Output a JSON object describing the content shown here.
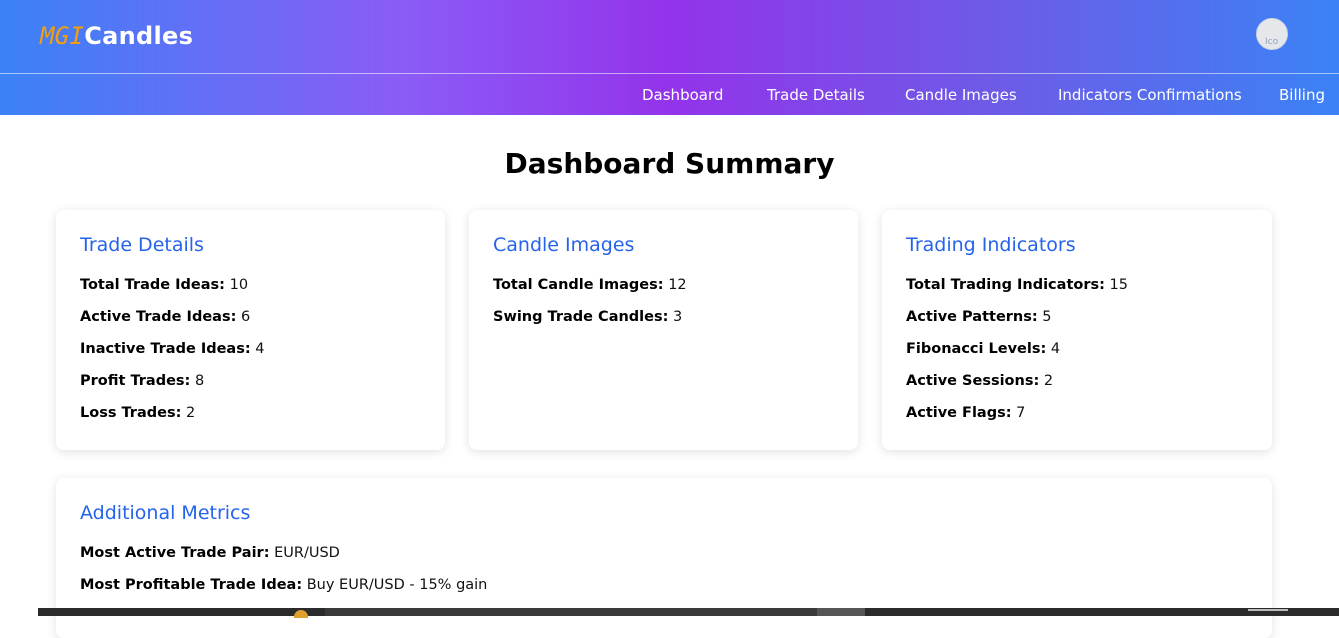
{
  "brand": {
    "mgi": "MGI",
    "name": "Candles"
  },
  "avatar": {
    "alt": "Ico"
  },
  "nav": [
    "Dashboard",
    "Trade Details",
    "Candle Images",
    "Indicators Confirmations",
    "Billing"
  ],
  "page_title": "Dashboard Summary",
  "cards": {
    "trade_details": {
      "title": "Trade Details",
      "rows": [
        {
          "label": "Total Trade Ideas:",
          "value": "10"
        },
        {
          "label": "Active Trade Ideas:",
          "value": "6"
        },
        {
          "label": "Inactive Trade Ideas:",
          "value": "4"
        },
        {
          "label": "Profit Trades:",
          "value": "8"
        },
        {
          "label": "Loss Trades:",
          "value": "2"
        }
      ]
    },
    "candle_images": {
      "title": "Candle Images",
      "rows": [
        {
          "label": "Total Candle Images:",
          "value": "12"
        },
        {
          "label": "Swing Trade Candles:",
          "value": "3"
        }
      ]
    },
    "trading_indicators": {
      "title": "Trading Indicators",
      "rows": [
        {
          "label": "Total Trading Indicators:",
          "value": "15"
        },
        {
          "label": "Active Patterns:",
          "value": "5"
        },
        {
          "label": "Fibonacci Levels:",
          "value": "4"
        },
        {
          "label": "Active Sessions:",
          "value": "2"
        },
        {
          "label": "Active Flags:",
          "value": "7"
        }
      ]
    },
    "additional_metrics": {
      "title": "Additional Metrics",
      "rows": [
        {
          "label": "Most Active Trade Pair:",
          "value": "EUR/USD"
        },
        {
          "label": "Most Profitable Trade Idea:",
          "value": "Buy EUR/USD - 15% gain"
        }
      ]
    }
  },
  "colors": {
    "accent": "#2563eb",
    "brand_orange": "#f59e0b",
    "gradient_mid": "#9333ea"
  }
}
